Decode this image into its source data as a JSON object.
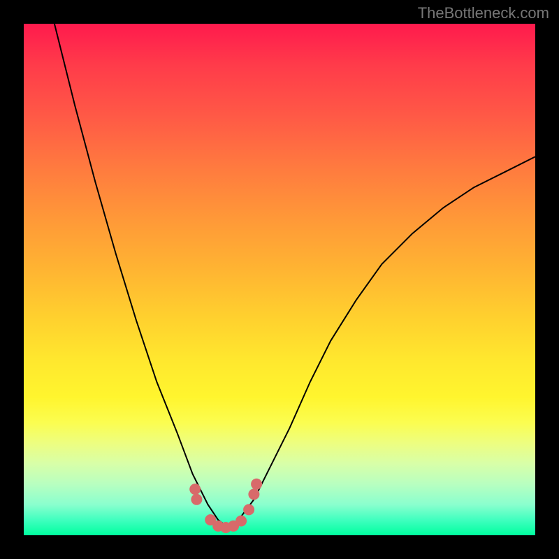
{
  "watermark": "TheBottleneck.com",
  "chart_data": {
    "type": "line",
    "title": "",
    "xlabel": "",
    "ylabel": "",
    "xlim": [
      0,
      100
    ],
    "ylim": [
      0,
      100
    ],
    "series": [
      {
        "name": "bottleneck-curve",
        "x": [
          6,
          10,
          14,
          18,
          22,
          26,
          30,
          33,
          36,
          38,
          40,
          42,
          45,
          48,
          52,
          56,
          60,
          65,
          70,
          76,
          82,
          88,
          94,
          100
        ],
        "y": [
          100,
          84,
          69,
          55,
          42,
          30,
          20,
          12,
          6,
          3,
          1.5,
          3,
          7,
          13,
          21,
          30,
          38,
          46,
          53,
          59,
          64,
          68,
          71,
          74
        ]
      }
    ],
    "markers": {
      "name": "highlighted-region",
      "x": [
        33.5,
        33.8,
        36.5,
        38,
        39.5,
        41,
        42.5,
        44,
        45,
        45.5
      ],
      "y": [
        9,
        7,
        3,
        1.8,
        1.5,
        1.8,
        2.8,
        5,
        8,
        10
      ]
    },
    "gradient_meaning": "vertical gradient from red (top) through orange, yellow to green (bottom); curve dips into green zone"
  }
}
